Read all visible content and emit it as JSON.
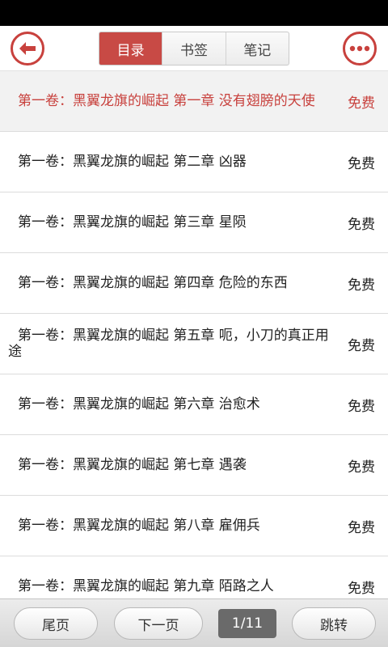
{
  "header": {
    "back_icon": "back-arrow-icon",
    "more_icon": "more-dots-icon",
    "accent_color": "#c8413d",
    "tabs": [
      {
        "label": "目录",
        "active": true
      },
      {
        "label": "书签",
        "active": false
      },
      {
        "label": "笔记",
        "active": false
      }
    ]
  },
  "chapters": [
    {
      "title": "第一卷：黑翼龙旗的崛起 第一章 没有翅膀的天使",
      "price": "免费",
      "current": true
    },
    {
      "title": "第一卷：黑翼龙旗的崛起 第二章 凶器",
      "price": "免费",
      "current": false
    },
    {
      "title": "第一卷：黑翼龙旗的崛起 第三章 星陨",
      "price": "免费",
      "current": false
    },
    {
      "title": "第一卷：黑翼龙旗的崛起 第四章 危险的东西",
      "price": "免费",
      "current": false
    },
    {
      "title": "第一卷：黑翼龙旗的崛起 第五章 呃，小刀的真正用途",
      "price": "免费",
      "current": false
    },
    {
      "title": "第一卷：黑翼龙旗的崛起 第六章 治愈术",
      "price": "免费",
      "current": false
    },
    {
      "title": "第一卷：黑翼龙旗的崛起 第七章 遇袭",
      "price": "免费",
      "current": false
    },
    {
      "title": "第一卷：黑翼龙旗的崛起 第八章 雇佣兵",
      "price": "免费",
      "current": false
    },
    {
      "title": "第一卷：黑翼龙旗的崛起 第九章 陌路之人",
      "price": "免费",
      "current": false
    }
  ],
  "footer": {
    "first_label": "尾页",
    "next_label": "下一页",
    "page_indicator": "1/11",
    "jump_label": "跳转"
  }
}
